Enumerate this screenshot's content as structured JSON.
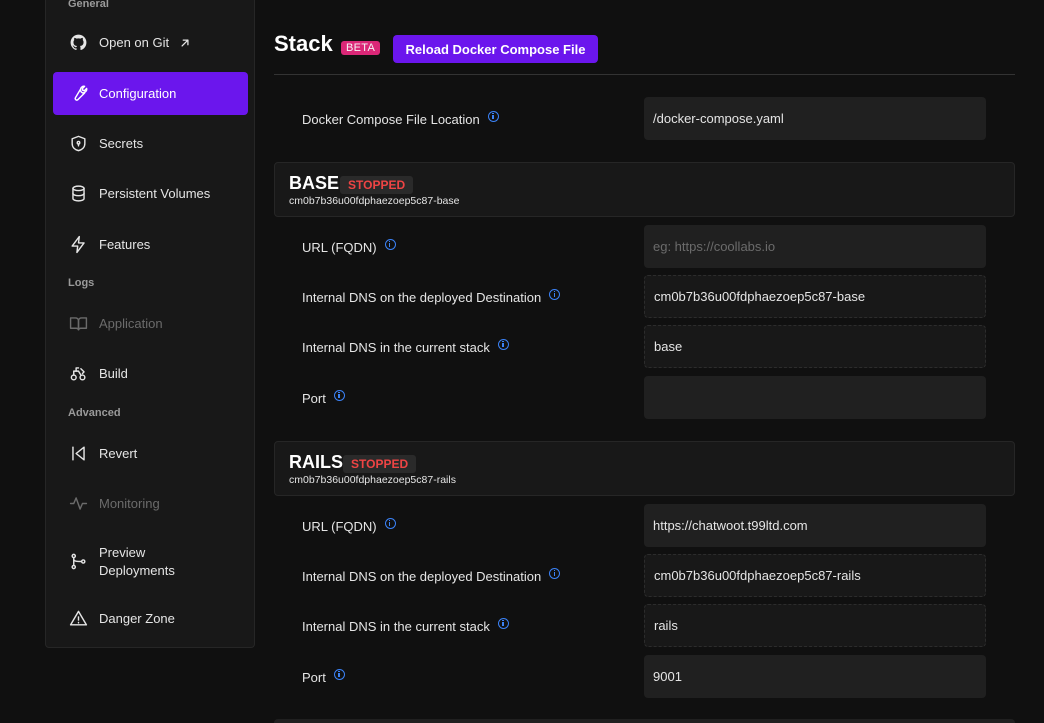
{
  "sidebar": {
    "section_general": "General",
    "section_logs": "Logs",
    "section_advanced": "Advanced",
    "items": [
      {
        "label": "Open on Git",
        "icon": "github-icon"
      },
      {
        "label": "Configuration",
        "icon": "wrench-icon",
        "active": true
      },
      {
        "label": "Secrets",
        "icon": "shield-icon"
      },
      {
        "label": "Persistent Volumes",
        "icon": "database-icon"
      },
      {
        "label": "Features",
        "icon": "lightning-icon"
      },
      {
        "label": "Application",
        "icon": "book-icon",
        "disabled": true
      },
      {
        "label": "Build",
        "icon": "build-icon"
      },
      {
        "label": "Revert",
        "icon": "revert-icon"
      },
      {
        "label": "Monitoring",
        "icon": "pulse-icon",
        "disabled": true
      },
      {
        "label": "Preview",
        "label2": "Deployments",
        "icon": "git-branch-icon"
      },
      {
        "label": "Danger Zone",
        "icon": "warning-icon"
      }
    ]
  },
  "header": {
    "title": "Stack",
    "beta": "BETA",
    "reload_button": "Reload Docker Compose File"
  },
  "compose": {
    "label": "Docker Compose File Location",
    "value": "/docker-compose.yaml"
  },
  "services": [
    {
      "name": "BASE",
      "status": "STOPPED",
      "id": "cm0b7b36u00fdphaezoep5c87-base",
      "url_label": "URL (FQDN)",
      "url_placeholder": "eg: https://coollabs.io",
      "dns_dest_label": "Internal DNS on the deployed Destination",
      "dns_dest_value": "cm0b7b36u00fdphaezoep5c87-base",
      "dns_stack_label": "Internal DNS in the current stack",
      "dns_stack_value": "base",
      "port_label": "Port",
      "port_value": ""
    },
    {
      "name": "RAILS",
      "status": "STOPPED",
      "id": "cm0b7b36u00fdphaezoep5c87-rails",
      "url_label": "URL (FQDN)",
      "url_value": "https://chatwoot.t99ltd.com",
      "dns_dest_label": "Internal DNS on the deployed Destination",
      "dns_dest_value": "cm0b7b36u00fdphaezoep5c87-rails",
      "dns_stack_label": "Internal DNS in the current stack",
      "dns_stack_value": "rails",
      "port_label": "Port",
      "port_value": "9001"
    }
  ],
  "colors": {
    "accent": "#6b16ed",
    "beta": "#db2777",
    "stopped": "#ef4444",
    "info": "#3b82f6"
  }
}
